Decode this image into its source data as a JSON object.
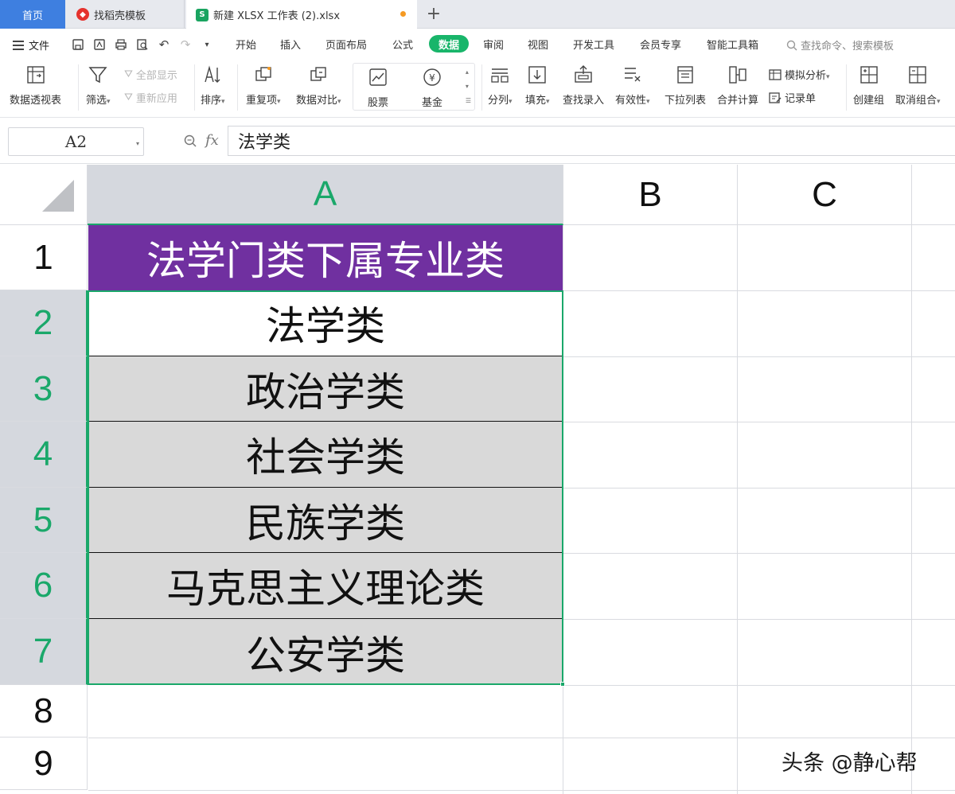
{
  "tabs": {
    "home": "首页",
    "template": "找稻壳模板",
    "file": "新建 XLSX 工作表 (2).xlsx",
    "add": "+"
  },
  "menu": {
    "file": "文件",
    "items": [
      "开始",
      "插入",
      "页面布局",
      "公式",
      "数据",
      "审阅",
      "视图",
      "开发工具",
      "会员专享",
      "智能工具箱"
    ],
    "active": "数据",
    "search": "查找命令、搜索模板"
  },
  "ribbon": {
    "pivot": "数据透视表",
    "filter": "筛选",
    "show_all": "全部显示",
    "reapply": "重新应用",
    "sort": "排序",
    "duplicates": "重复项",
    "compare": "数据对比",
    "stocks": "股票",
    "funds": "基金",
    "split": "分列",
    "fill": "填充",
    "lookup_entry": "查找录入",
    "validity": "有效性",
    "dropdown_list": "下拉列表",
    "consolidate": "合并计算",
    "what_if": "模拟分析",
    "record_form": "记录单",
    "create_group": "创建组",
    "ungroup": "取消组合"
  },
  "formula_bar": {
    "name_box": "A2",
    "fx": "fx",
    "content": "法学类"
  },
  "grid": {
    "columns": [
      "A",
      "B",
      "C"
    ],
    "rows": [
      "1",
      "2",
      "3",
      "4",
      "5",
      "6",
      "7",
      "8",
      "9"
    ],
    "cells": {
      "A1": "法学门类下属专业类",
      "A2": "法学类",
      "A3": "政治学类",
      "A4": "社会学类",
      "A5": "民族学类",
      "A6": "马克思主义理论类",
      "A7": "公安学类"
    }
  },
  "colors": {
    "accent": "#18b56a",
    "header_fill": "#7030a0",
    "row_fill": "#d9d9d9",
    "home_tab": "#3e7fe0"
  },
  "watermark": "头条 @静心帮"
}
